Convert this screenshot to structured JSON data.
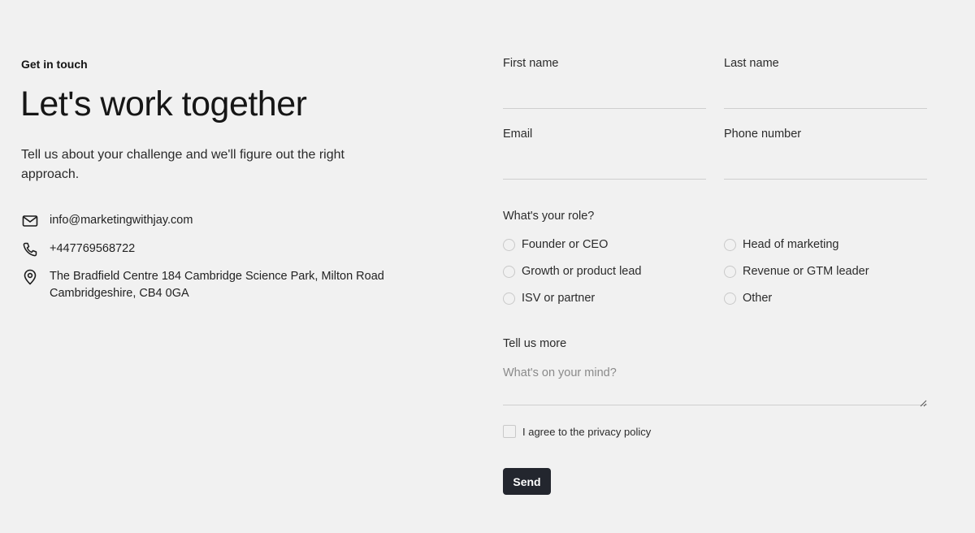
{
  "intro_section": {
    "eyebrow": "Get in touch",
    "headline": "Let's work together",
    "description": "Tell us about your challenge and we'll figure out the right approach."
  },
  "contact": {
    "email": "info@marketingwithjay.com",
    "phone": "+447769568722",
    "address_line1": "The Bradfield Centre 184 Cambridge Science Park, Milton Road",
    "address_line2": "Cambridgeshire, CB4 0GA",
    "icons": [
      "mail-icon",
      "phone-icon",
      "location-pin-icon"
    ]
  },
  "form": {
    "first_name": {
      "label": "First name",
      "value": ""
    },
    "last_name": {
      "label": "Last name",
      "value": ""
    },
    "email": {
      "label": "Email",
      "value": ""
    },
    "phone": {
      "label": "Phone number",
      "value": ""
    },
    "role": {
      "label": "What's your role?",
      "options": [
        "Founder or CEO",
        "Head of marketing",
        "Growth or product lead",
        "Revenue or GTM leader",
        "ISV or partner",
        "Other"
      ],
      "selected": null
    },
    "message": {
      "label": "Tell us more",
      "placeholder": "What's on your mind?",
      "value": ""
    },
    "privacy": {
      "label": "I agree to the privacy policy",
      "checked": false
    },
    "submit_label": "Send"
  },
  "colors": {
    "background": "#f1f1f1",
    "button_bg": "#23262e",
    "button_text": "#ffffff",
    "input_underline": "#cfcfcf"
  }
}
